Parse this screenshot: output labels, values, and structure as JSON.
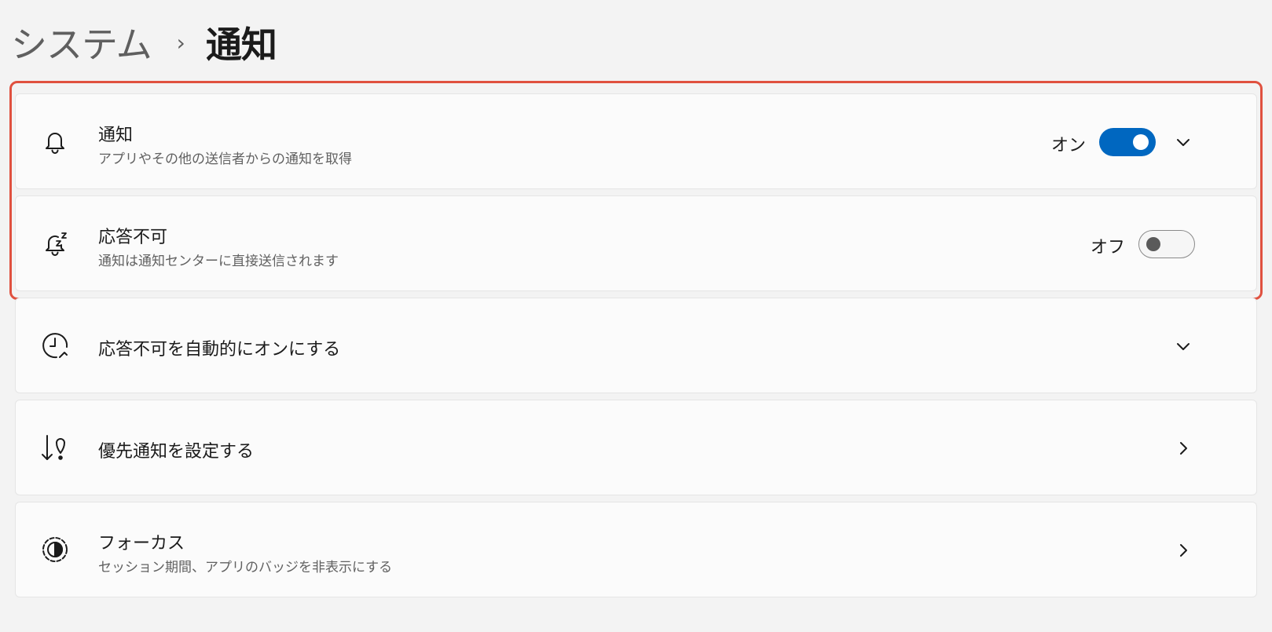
{
  "breadcrumb": {
    "parent": "システム",
    "separator": "›",
    "current": "通知"
  },
  "cards": {
    "notifications": {
      "title": "通知",
      "subtitle": "アプリやその他の送信者からの通知を取得",
      "toggle_label": "オン",
      "toggle_state": "on",
      "icon": "bell-icon"
    },
    "dnd": {
      "title": "応答不可",
      "subtitle": "通知は通知センターに直接送信されます",
      "toggle_label": "オフ",
      "toggle_state": "off",
      "icon": "snooze-bell-icon"
    },
    "auto_dnd": {
      "title": "応答不可を自動的にオンにする",
      "icon": "clock-icon"
    },
    "priority": {
      "title": "優先通知を設定する",
      "icon": "priority-icon"
    },
    "focus": {
      "title": "フォーカス",
      "subtitle": "セッション期間、アプリのバッジを非表示にする",
      "icon": "focus-icon"
    }
  },
  "colors": {
    "accent": "#0067c0",
    "highlight": "#e0513f",
    "background": "#f3f3f3",
    "card": "#fbfbfb"
  }
}
